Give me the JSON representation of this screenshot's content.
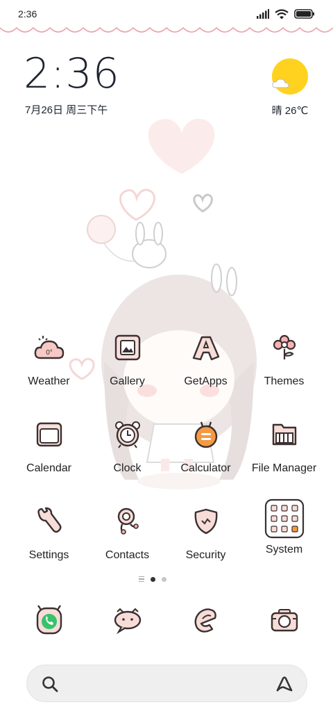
{
  "status_bar": {
    "time": "2:36",
    "icons": [
      "signal-icon",
      "wifi-icon",
      "battery-icon"
    ]
  },
  "clock_widget": {
    "time": "2:36",
    "date": "7月26日 周三下午"
  },
  "weather_widget": {
    "icon": "sunny-cloud-icon",
    "text": "晴 26℃",
    "sun_color": "#ffd21f"
  },
  "apps": [
    {
      "label": "Weather",
      "icon": "weather-icon"
    },
    {
      "label": "Gallery",
      "icon": "gallery-icon"
    },
    {
      "label": "GetApps",
      "icon": "getapps-icon"
    },
    {
      "label": "Themes",
      "icon": "themes-icon"
    },
    {
      "label": "Calendar",
      "icon": "calendar-icon"
    },
    {
      "label": "Clock",
      "icon": "clock-icon"
    },
    {
      "label": "Calculator",
      "icon": "calculator-icon"
    },
    {
      "label": "File Manager",
      "icon": "file-manager-icon"
    },
    {
      "label": "Settings",
      "icon": "settings-icon"
    },
    {
      "label": "Contacts",
      "icon": "contacts-icon"
    },
    {
      "label": "Security",
      "icon": "security-icon"
    },
    {
      "label": "System",
      "icon": "system-folder-icon"
    }
  ],
  "weather_icon_text": "0°",
  "page_indicator": {
    "pages": 2,
    "active": 1
  },
  "dock": [
    {
      "icon": "phone-icon"
    },
    {
      "icon": "messages-icon"
    },
    {
      "icon": "browser-icon"
    },
    {
      "icon": "camera-icon"
    }
  ],
  "search": {
    "icon": "search-icon",
    "assistant_icon": "assistant-icon"
  },
  "colors": {
    "accent_pink": "#f2b8b8",
    "outline": "#3a3030",
    "orange": "#f39a43",
    "green": "#37c26b"
  }
}
